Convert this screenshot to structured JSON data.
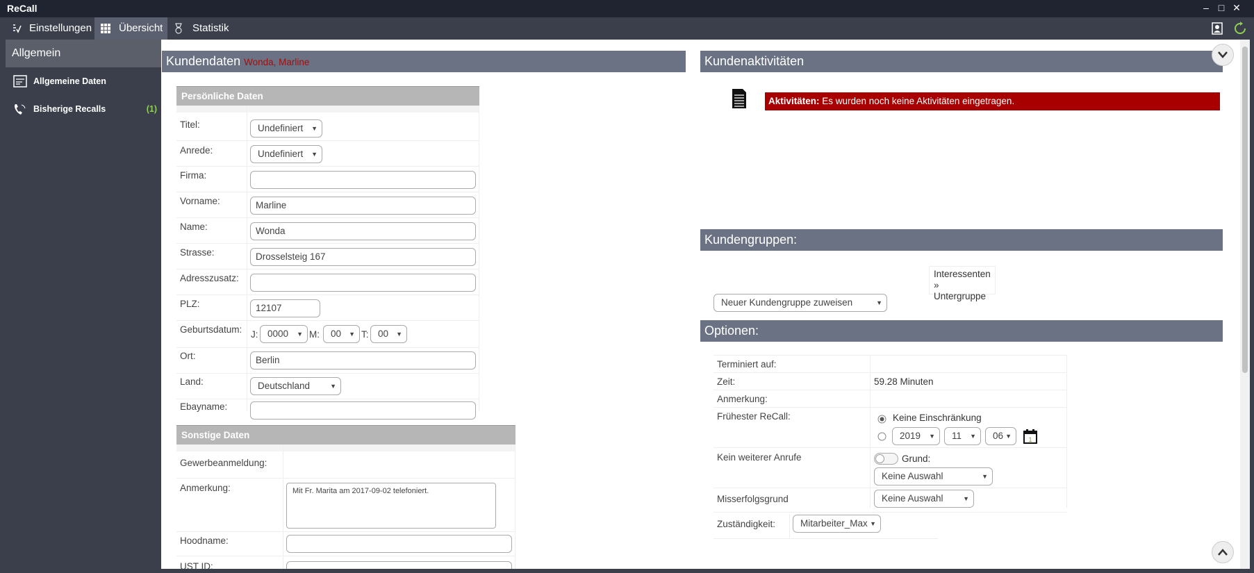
{
  "app": {
    "title": "ReCall",
    "win_min": "–",
    "win_max": "□",
    "win_close": "✕"
  },
  "menu": {
    "einstellungen": "Einstellungen",
    "uebersicht": "Übersicht",
    "statistik": "Statistik"
  },
  "sidebar": {
    "header": "Allgemein",
    "items": [
      {
        "label": "Allgemeine Daten"
      },
      {
        "label": "Bisherige Recalls",
        "count": "(1)"
      }
    ]
  },
  "kundendaten": {
    "title": "Kundendaten",
    "name": "Wonda, Marline"
  },
  "personal": {
    "header": "Persönliche Daten",
    "titel_label": "Titel:",
    "titel_value": "Undefiniert",
    "anrede_label": "Anrede:",
    "anrede_value": "Undefiniert",
    "firma_label": "Firma:",
    "firma_value": "",
    "vorname_label": "Vorname:",
    "vorname_value": "Marline",
    "name_label": "Name:",
    "name_value": "Wonda",
    "strasse_label": "Strasse:",
    "strasse_value": "Drosselsteig 167",
    "adresszusatz_label": "Adresszusatz:",
    "adresszusatz_value": "",
    "plz_label": "PLZ:",
    "plz_value": "12107",
    "geburtsdatum_label": "Geburtsdatum:",
    "j_label": "J:",
    "j_value": "0000",
    "m_label": "M:",
    "m_value": "00",
    "t_label": "T:",
    "t_value": "00",
    "ort_label": "Ort:",
    "ort_value": "Berlin",
    "land_label": "Land:",
    "land_value": "Deutschland",
    "ebayname_label": "Ebayname:",
    "ebayname_value": ""
  },
  "sonstige": {
    "header": "Sonstige Daten",
    "gewerbe_label": "Gewerbeanmeldung:",
    "anmerkung_label": "Anmerkung:",
    "anmerkung_value": "Mit Fr. Marita am 2017-09-02 telefoniert.",
    "hoodname_label": "Hoodname:",
    "ustid_label": "UST ID:"
  },
  "aktivitaeten": {
    "title": "Kundenaktivitäten",
    "alert_bold": "Aktivitäten:",
    "alert_text": " Es wurden noch keine Aktivitäten eingetragen."
  },
  "gruppen": {
    "title": "Kundengruppen:",
    "group_line1": "Interessenten »",
    "group_line2": "Untergruppe",
    "assign": "Neuer Kundengruppe zuweisen"
  },
  "optionen": {
    "title": "Optionen:",
    "terminiert_label": "Terminiert auf:",
    "zeit_label": "Zeit:",
    "zeit_value": "59.28 Minuten",
    "anmerkung_label": "Anmerkung:",
    "recall_label": "Frühester ReCall:",
    "keine_einschraenkung": "Keine Einschränkung",
    "year": "2019",
    "month": "11",
    "day": "06",
    "kein_anrufe_label": "Kein weiterer Anrufe",
    "grund_label": "Grund:",
    "grund_value": "Keine Auswahl",
    "misserfolg_label": "Misserfolgsgrund",
    "misserfolg_value": "Keine Auswahl",
    "zustaendigkeit_label": "Zuständigkeit:",
    "zustaendigkeit_value": "Mitarbeiter_Max"
  },
  "colors": {
    "accent_green": "#8fd14f",
    "alert_red": "#a80000",
    "section_gray": "#6b7283"
  }
}
